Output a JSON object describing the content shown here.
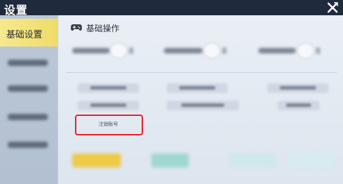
{
  "header": {
    "title": "设置",
    "close_icon": "close-icon"
  },
  "sidebar": {
    "items": [
      {
        "label": "基础设置",
        "active": true
      },
      {
        "label": "",
        "active": false
      },
      {
        "label": "",
        "active": false
      },
      {
        "label": "",
        "active": false
      },
      {
        "label": "",
        "active": false
      }
    ]
  },
  "main": {
    "section_title": "基础操作",
    "section_icon": "gamepad-icon",
    "cancel_account_label": "注销账号"
  },
  "colors": {
    "header_bg": "#1f2a3d",
    "active_tab": "#efdc68",
    "highlight": "#e8202a"
  }
}
